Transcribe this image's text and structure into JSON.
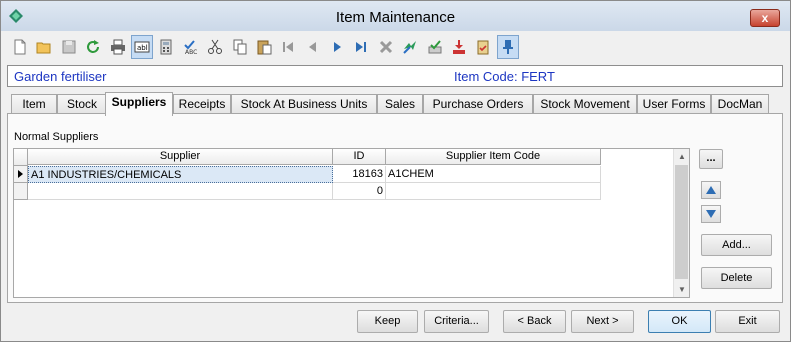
{
  "window": {
    "title": "Item Maintenance",
    "close_label": "x"
  },
  "toolbar": {
    "items": [
      {
        "name": "new-icon"
      },
      {
        "name": "open-icon"
      },
      {
        "name": "save-icon"
      },
      {
        "name": "refresh-icon"
      },
      {
        "name": "print-icon"
      },
      {
        "name": "field-label-icon"
      },
      {
        "name": "calculator-icon"
      },
      {
        "name": "spellcheck-icon"
      },
      {
        "name": "cut-icon"
      },
      {
        "name": "copy-icon"
      },
      {
        "name": "paste-icon"
      },
      {
        "name": "first-record-icon"
      },
      {
        "name": "previous-record-icon"
      },
      {
        "name": "next-record-icon"
      },
      {
        "name": "last-record-icon"
      },
      {
        "name": "delete-icon"
      },
      {
        "name": "send-icon"
      },
      {
        "name": "approve-icon"
      },
      {
        "name": "download-icon"
      },
      {
        "name": "clipboard-check-icon"
      },
      {
        "name": "pin-icon"
      }
    ]
  },
  "item": {
    "description": "Garden fertiliser",
    "code_label": "Item Code: FERT"
  },
  "tabs": [
    "Item",
    "Stock",
    "Suppliers",
    "Receipts",
    "Stock At Business Units",
    "Sales",
    "Purchase Orders",
    "Stock Movement",
    "User Forms",
    "DocMan"
  ],
  "active_tab": "Suppliers",
  "suppliers": {
    "section_label": "Normal Suppliers",
    "columns": [
      "Supplier",
      "ID",
      "Supplier Item Code"
    ],
    "rows": [
      {
        "supplier": "A1 INDUSTRIES/CHEMICALS",
        "id": "18163",
        "code": "A1CHEM"
      },
      {
        "supplier": "",
        "id": "0",
        "code": ""
      }
    ]
  },
  "side_buttons": {
    "browse": "...",
    "add": "Add...",
    "delete": "Delete"
  },
  "buttons": {
    "keep": "Keep",
    "criteria": "Criteria...",
    "back": "< Back",
    "next": "Next >",
    "ok": "OK",
    "exit": "Exit"
  },
  "colors": {
    "accent_text": "#1d36c2",
    "selected_row": "#dbe8f6",
    "arrow_blue": "#2e6db4"
  }
}
